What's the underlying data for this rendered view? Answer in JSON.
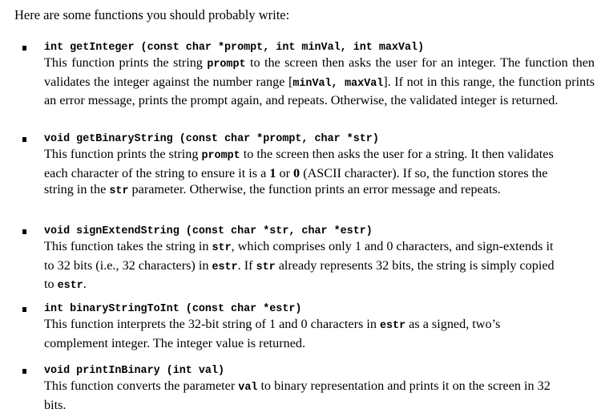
{
  "intro": "Here are some functions you should probably write:",
  "functions": [
    {
      "signature": "int getInteger (const char *prompt, int minVal, int maxVal)",
      "desc": [
        {
          "t": "This function prints the string "
        },
        {
          "c": "prompt"
        },
        {
          "t": " to the screen then asks the user for an integer. The function then validates the integer against the number range ["
        },
        {
          "c": "minVal,  maxVal"
        },
        {
          "t": "]. If not in this range, the function prints an error message, prints the prompt again, and repeats. Otherwise,  the validated integer is returned."
        }
      ]
    },
    {
      "signature": "void getBinaryString (const char *prompt, char *str)",
      "desc": [
        {
          "t": "This function prints the string "
        },
        {
          "c": "prompt"
        },
        {
          "t": "  to the screen then asks the user for a string. It then validates each character of the string to ensure it is a "
        },
        {
          "b": "1"
        },
        {
          "t": " or "
        },
        {
          "b": "0"
        },
        {
          "t": " (ASCII character). If so, the function stores the string in the "
        },
        {
          "c": "str"
        },
        {
          "t": " parameter. Otherwise, the function prints an error message and repeats."
        }
      ]
    },
    {
      "signature": "void signExtendString (const char *str, char *estr)",
      "desc": [
        {
          "t": "This function takes the string in "
        },
        {
          "c": "str"
        },
        {
          "t": ", which comprises only 1 and 0 characters, and sign-extends it to 32 bits (i.e., 32 characters) in "
        },
        {
          "c": "estr"
        },
        {
          "t": ". If "
        },
        {
          "c": "str"
        },
        {
          "t": " already represents 32 bits, the string is simply copied to "
        },
        {
          "c": "estr"
        },
        {
          "t": "."
        }
      ]
    },
    {
      "signature": "int binaryStringToInt (const char *estr)",
      "desc": [
        {
          "t": "This function interprets the 32-bit string of 1 and 0 characters in "
        },
        {
          "c": "estr"
        },
        {
          "t": " as a signed, two’s complement integer. The integer value is returned."
        }
      ]
    },
    {
      "signature": "void printInBinary (int val)",
      "desc": [
        {
          "t": "This function converts the parameter "
        },
        {
          "c": "val"
        },
        {
          "t": " to binary representation and prints it on the screen in 32 bits."
        }
      ]
    }
  ]
}
